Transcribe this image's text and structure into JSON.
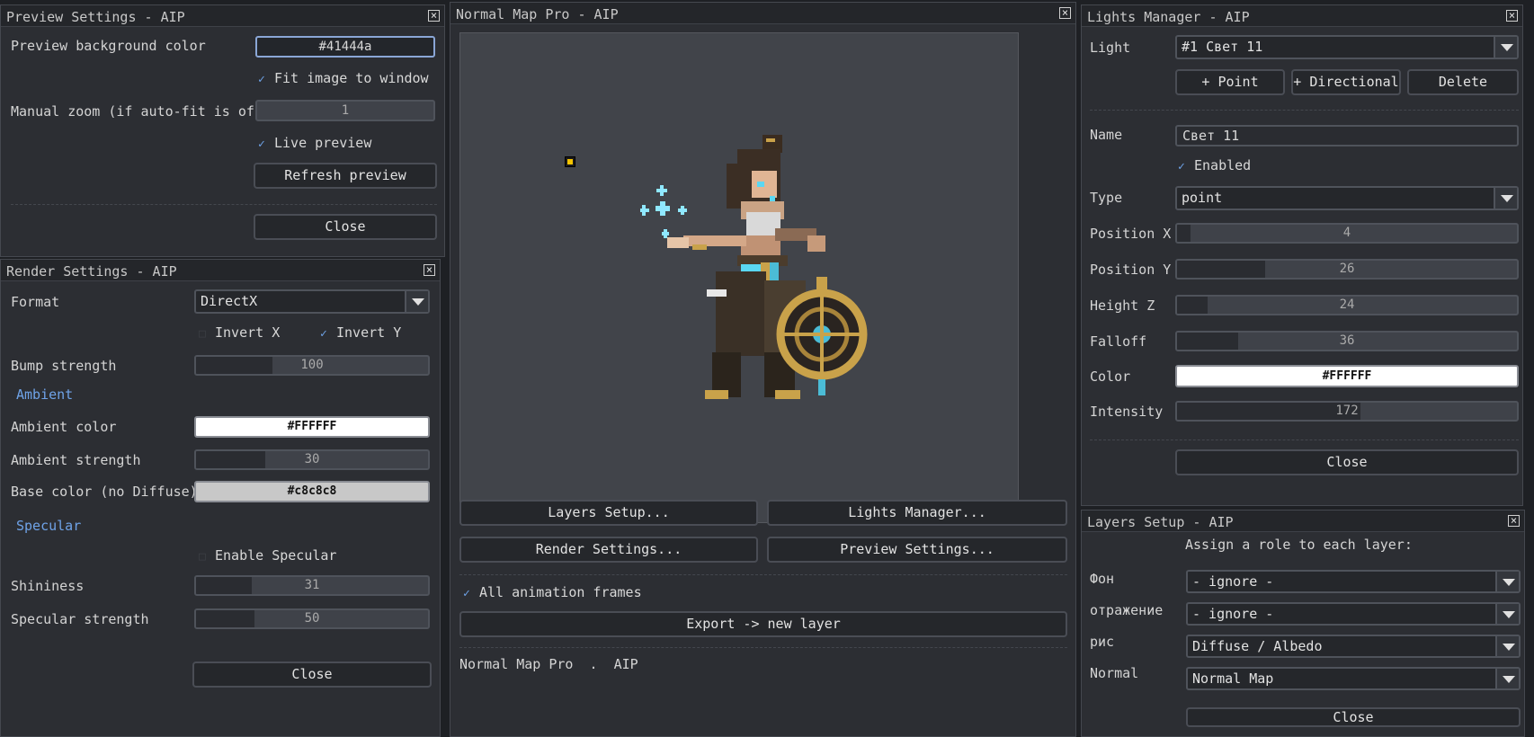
{
  "preview": {
    "title": "Preview Settings - AIP",
    "bg_label": "Preview background color",
    "bg_value": "#41444a",
    "fit_label": "Fit image to window",
    "zoom_label": "Manual zoom (if auto-fit is off)",
    "zoom_value": "1",
    "live_label": "Live preview",
    "refresh_label": "Refresh preview",
    "close_label": "Close"
  },
  "render": {
    "title": "Render Settings - AIP",
    "format_label": "Format",
    "format_value": "DirectX",
    "invert_x_label": "Invert X",
    "invert_y_label": "Invert Y",
    "bump_label": "Bump strength",
    "bump_value": "100",
    "ambient_section": "Ambient",
    "ambient_color_label": "Ambient color",
    "ambient_color_value": "#FFFFFF",
    "ambient_strength_label": "Ambient strength",
    "ambient_strength_value": "30",
    "base_color_label": "Base color (no Diffuse)",
    "base_color_value": "#c8c8c8",
    "specular_section": "Specular",
    "enable_specular_label": "Enable Specular",
    "shininess_label": "Shininess",
    "shininess_value": "31",
    "spec_strength_label": "Specular strength",
    "spec_strength_value": "50",
    "close_label": "Close"
  },
  "main": {
    "title": "Normal Map Pro - AIP",
    "layers_btn": "Layers Setup...",
    "lights_btn": "Lights Manager...",
    "render_btn": "Render Settings...",
    "preview_btn": "Preview Settings...",
    "all_frames_label": "All animation frames",
    "export_btn": "Export -> new layer",
    "footer": "Normal Map Pro  .  AIP"
  },
  "lights": {
    "title": "Lights Manager - AIP",
    "light_label": "Light",
    "light_value": "#1 Свет 11",
    "point_btn": "+ Point",
    "directional_btn": "+ Directional",
    "delete_btn": "Delete",
    "name_label": "Name",
    "name_value": "Свет 11",
    "enabled_label": "Enabled",
    "type_label": "Type",
    "type_value": "point",
    "pos_x_label": "Position X",
    "pos_x_value": "4",
    "pos_y_label": "Position Y",
    "pos_y_value": "26",
    "height_label": "Height Z",
    "height_value": "24",
    "falloff_label": "Falloff",
    "falloff_value": "36",
    "color_label": "Color",
    "color_value": "#FFFFFF",
    "intensity_label": "Intensity",
    "intensity_value": "172",
    "close_label": "Close"
  },
  "layers": {
    "title": "Layers Setup - AIP",
    "instruction": "Assign a role to each layer:",
    "rows": [
      {
        "label": "Фон",
        "value": "- ignore -"
      },
      {
        "label": "отражение",
        "value": "- ignore -"
      },
      {
        "label": "рис",
        "value": "Diffuse / Albedo"
      },
      {
        "label": "Normal",
        "value": "Normal Map"
      }
    ],
    "close_label": "Close"
  },
  "colors": {
    "accent": "#6fa3e8",
    "panel": "#2c2e33",
    "canvas": "#41444a"
  }
}
